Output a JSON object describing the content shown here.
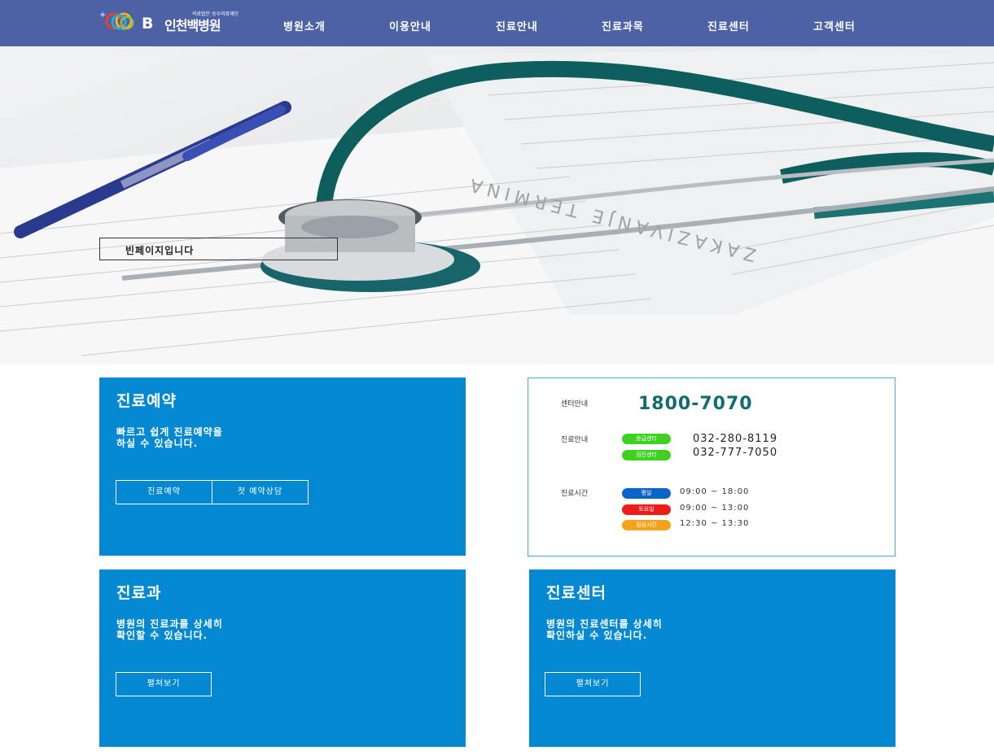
{
  "header": {
    "logo_sub": "의료법인 승수의료재단",
    "logo_mark": "B",
    "logo_name": "인천백병원",
    "nav": [
      "병원소개",
      "이용안내",
      "진료안내",
      "진료과목",
      "진료센터",
      "고객센터"
    ]
  },
  "hero": {
    "message": "빈페이지입니다"
  },
  "reservation": {
    "title": "진료예약",
    "desc_line1": "빠르고 쉽게 진료예약을",
    "desc_line2": "하실 수 있습니다.",
    "btn_reserve": "진료예약",
    "btn_consult": "첫 예약상담"
  },
  "info": {
    "center_label": "센터안내",
    "center_phone": "1800-7070",
    "guide_label": "진료안내",
    "emergency_badge": "응급센터",
    "emergency_phone": "032-280-8119",
    "checkup_badge": "검진센터",
    "checkup_phone": "032-777-7050",
    "hours_label": "진료시간",
    "weekday_badge": "평일",
    "weekday_hours": "09:00 ~ 18:00",
    "saturday_badge": "토요일",
    "saturday_hours": "09:00 ~ 13:00",
    "lunch_badge": "점심시간",
    "lunch_hours": "12:30 ~ 13:30"
  },
  "departments": {
    "title": "진료과",
    "desc_line1": "병원의 진료과를 상세히",
    "desc_line2": "확인할 수 있습니다.",
    "btn": "펼쳐보기"
  },
  "centers": {
    "title": "진료센터",
    "desc_line1": "병원의 진료센터를 상세히",
    "desc_line2": "확인하실 수 있습니다.",
    "btn": "펼쳐보기"
  },
  "colors": {
    "header_bg": "#4d62a5",
    "card_blue": "#0388d1",
    "phone_teal": "#126b6e",
    "badge_green": "#3ed11f",
    "badge_blue": "#0a63c9",
    "badge_red": "#ee1b1b",
    "badge_orange": "#f5a31a"
  }
}
